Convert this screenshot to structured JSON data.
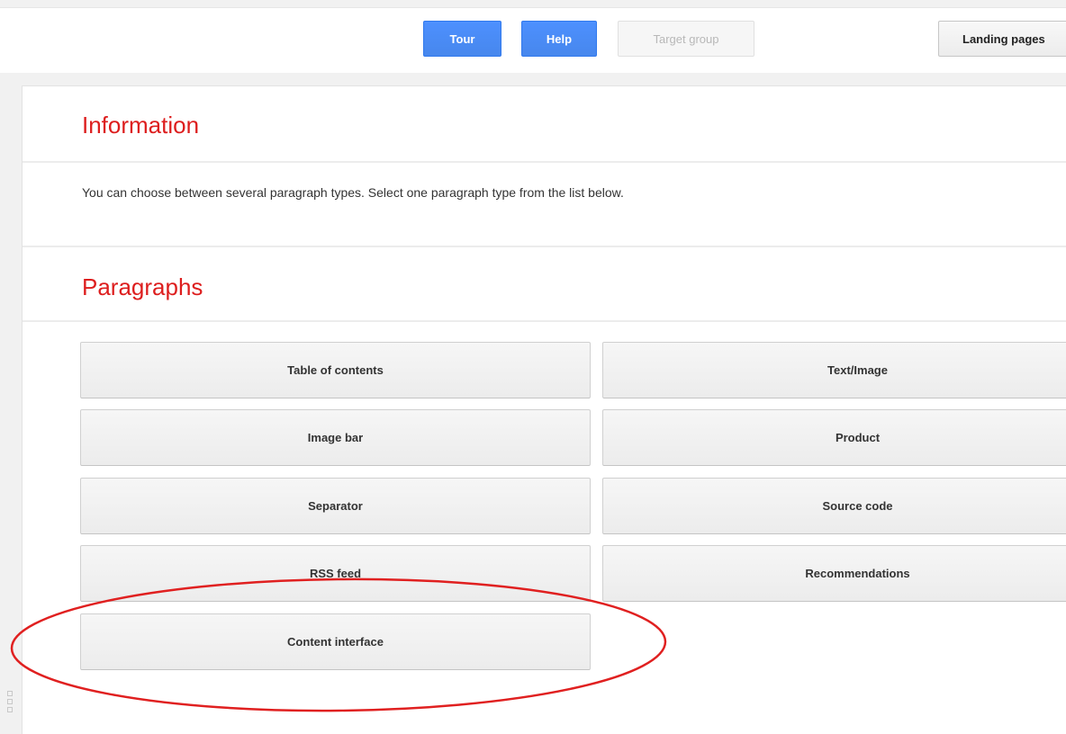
{
  "toolbar": {
    "tour_label": "Tour",
    "help_label": "Help",
    "target_group_label": "Target group",
    "landing_pages_label": "Landing pages"
  },
  "information": {
    "title": "Information",
    "text": "You can choose between several paragraph types. Select one paragraph type from the list below."
  },
  "paragraphs": {
    "title": "Paragraphs",
    "items": [
      {
        "label": "Table of contents"
      },
      {
        "label": "Text/Image"
      },
      {
        "label": "Image bar"
      },
      {
        "label": "Product"
      },
      {
        "label": "Separator"
      },
      {
        "label": "Source code"
      },
      {
        "label": "RSS feed"
      },
      {
        "label": "Recommendations"
      },
      {
        "label": "Content interface"
      }
    ]
  },
  "annotation": {
    "highlighted_item": "Content interface",
    "color": "#e02020"
  },
  "colors": {
    "accent_blue": "#4d90fe",
    "heading_red": "#dd1e1e"
  }
}
